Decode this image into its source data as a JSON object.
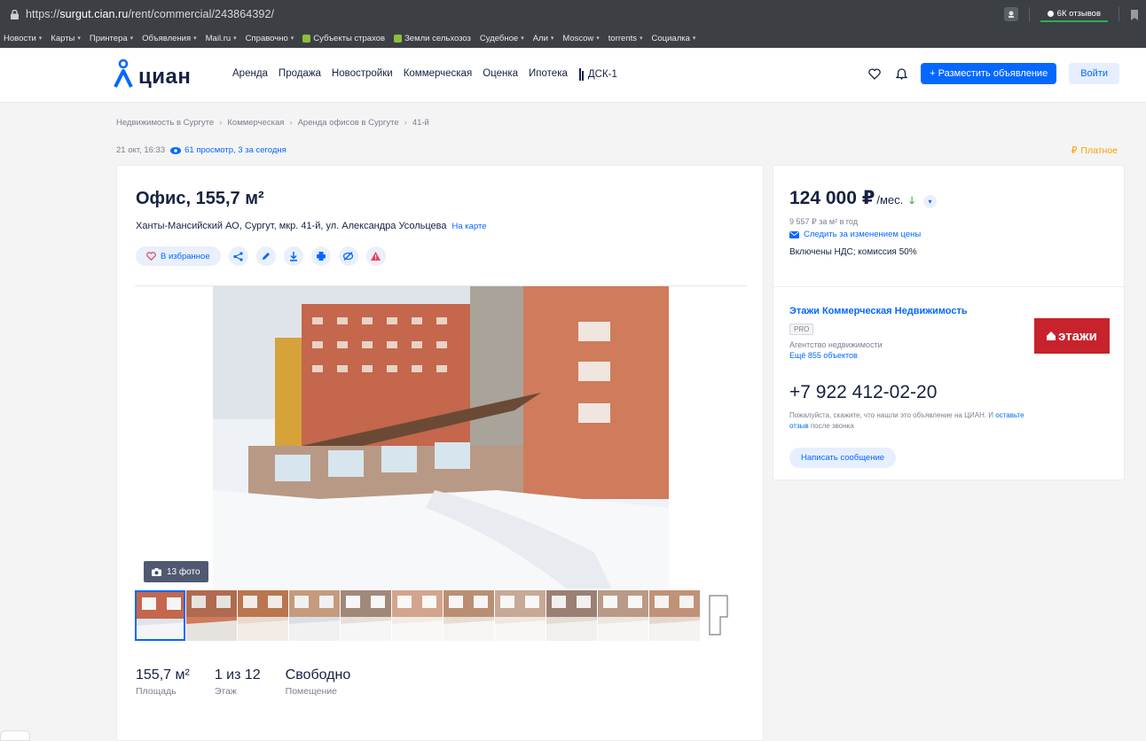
{
  "browser": {
    "url_prefix": "https://",
    "url_host": "surgut.cian.ru",
    "url_path": "/rent/commercial/243864392/",
    "reviews_badge": "6К отзывов",
    "icons": {
      "lock": "lock-icon",
      "extension": "extension-icon",
      "bookmark": "bookmark-icon"
    }
  },
  "bookmarks": [
    {
      "label": "Новости",
      "caret": "▾"
    },
    {
      "label": "Карты",
      "caret": "▾"
    },
    {
      "label": "Принтера",
      "caret": "▾"
    },
    {
      "label": "Объявления",
      "caret": "▾"
    },
    {
      "label": "Mail.ru",
      "caret": "▾"
    },
    {
      "label": "Справочно",
      "caret": "▾"
    },
    {
      "label": "Субъекты страхов",
      "caret": ""
    },
    {
      "label": "Земли сельхозоз",
      "caret": ""
    },
    {
      "label": "Судебное",
      "caret": "▾"
    },
    {
      "label": "Али",
      "caret": "▾"
    },
    {
      "label": "Moscow",
      "caret": "▾"
    },
    {
      "label": "torrents",
      "caret": "▾"
    },
    {
      "label": "Социалка",
      "caret": "▾"
    }
  ],
  "header": {
    "logo": "циан",
    "nav": [
      "Аренда",
      "Продажа",
      "Новостройки",
      "Коммерческая",
      "Оценка",
      "Ипотека"
    ],
    "dsk": "ДСК-1",
    "post_button": "+ Разместить объявление",
    "login_button": "Войти",
    "colors": {
      "brand": "#0468ff",
      "text": "#152242"
    }
  },
  "breadcrumbs": [
    "Недвижимость в Сургуте",
    "Коммерческая",
    "Аренда офисов в Сургуте",
    "41-й"
  ],
  "meta": {
    "date": "21 окт, 16:33",
    "views": "61 просмотр, 3 за сегодня",
    "paid": "Платное"
  },
  "listing": {
    "title": "Офис, 155,7 м²",
    "address": "Ханты-Мансийский АО, Сургут, мкр. 41-й, ул. Александра Усольцева",
    "map_link": "На карте",
    "favorite_label": "В избранное",
    "action_icons": [
      "share-icon",
      "edit-icon",
      "download-icon",
      "print-icon",
      "hide-icon",
      "complain-icon"
    ],
    "photo_count": "13 фото",
    "thumbnails_visible": 12,
    "stats": [
      {
        "value": "155,7 м²",
        "label": "Площадь"
      },
      {
        "value": "1 из 12",
        "label": "Этаж"
      },
      {
        "value": "Свободно",
        "label": "Помещение"
      }
    ]
  },
  "pricing": {
    "price": "124 000 ₽",
    "unit": "/мес.",
    "trend": "down",
    "per_sqm": "9 557 ₽ за м² в год",
    "follow": "Следить за изменением цены",
    "included": "Включены НДС; комиссия 50%"
  },
  "agent": {
    "name": "Этажи Коммерческая Недвижимость",
    "badge": "PRO",
    "type": "Агентство недвижимости",
    "more": "Ещё 855 объектов",
    "logo_text": "этажи",
    "phone": "+7 922 412-02-20",
    "note_prefix": "Пожалуйста, скажите, что нашли это объявление на ЦИАН. И ",
    "note_link": "оставьте отзыв",
    "note_suffix": " после звонка",
    "message_button": "Написать сообщение"
  }
}
